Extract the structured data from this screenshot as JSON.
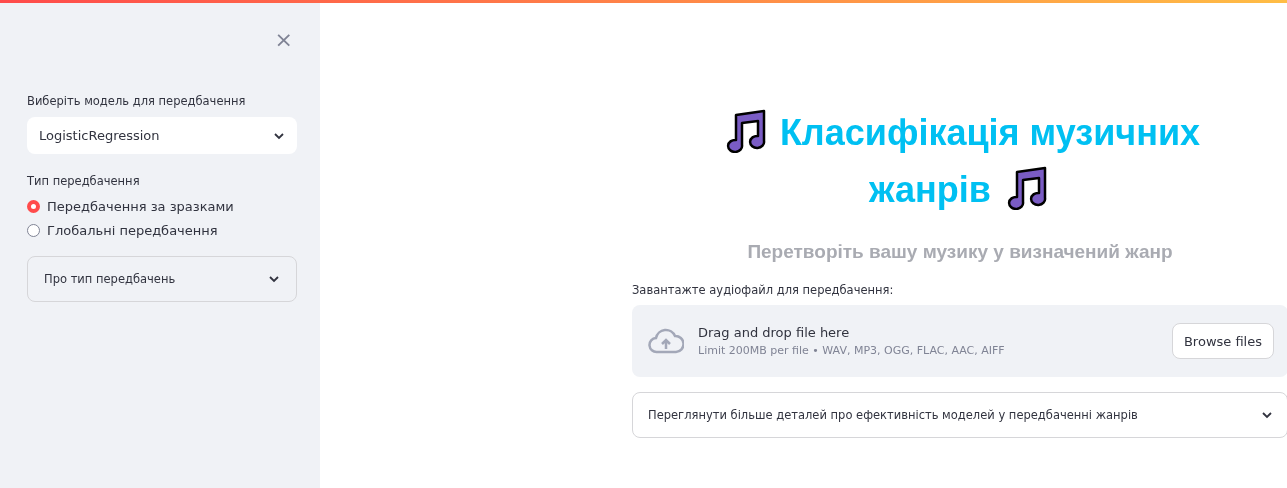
{
  "sidebar": {
    "close_icon": "×",
    "model_select": {
      "label": "Виберіть модель для передбачення",
      "value": "LogisticRegression"
    },
    "prediction_type": {
      "label": "Тип передбачення",
      "options": [
        {
          "label": "Передбачення за зразками",
          "selected": true
        },
        {
          "label": "Глобальні передбачення",
          "selected": false
        }
      ]
    },
    "expander": {
      "label": "Про тип передбачень",
      "expanded": false
    }
  },
  "main": {
    "title_lines": [
      "Класифікація музичних",
      "жанрів"
    ],
    "subtitle": "Перетворіть вашу музику у визначений жанр",
    "uploader": {
      "label": "Завантажте аудіофайл для передбачення:",
      "drop_text": "Drag and drop file here",
      "limit_text": "Limit 200MB per file • WAV, MP3, OGG, FLAC, AAC, AIFF",
      "button": "Browse files"
    },
    "expander": {
      "label": "Переглянути більше деталей про ефективність моделей у передбаченні жанрів",
      "expanded": false
    }
  }
}
